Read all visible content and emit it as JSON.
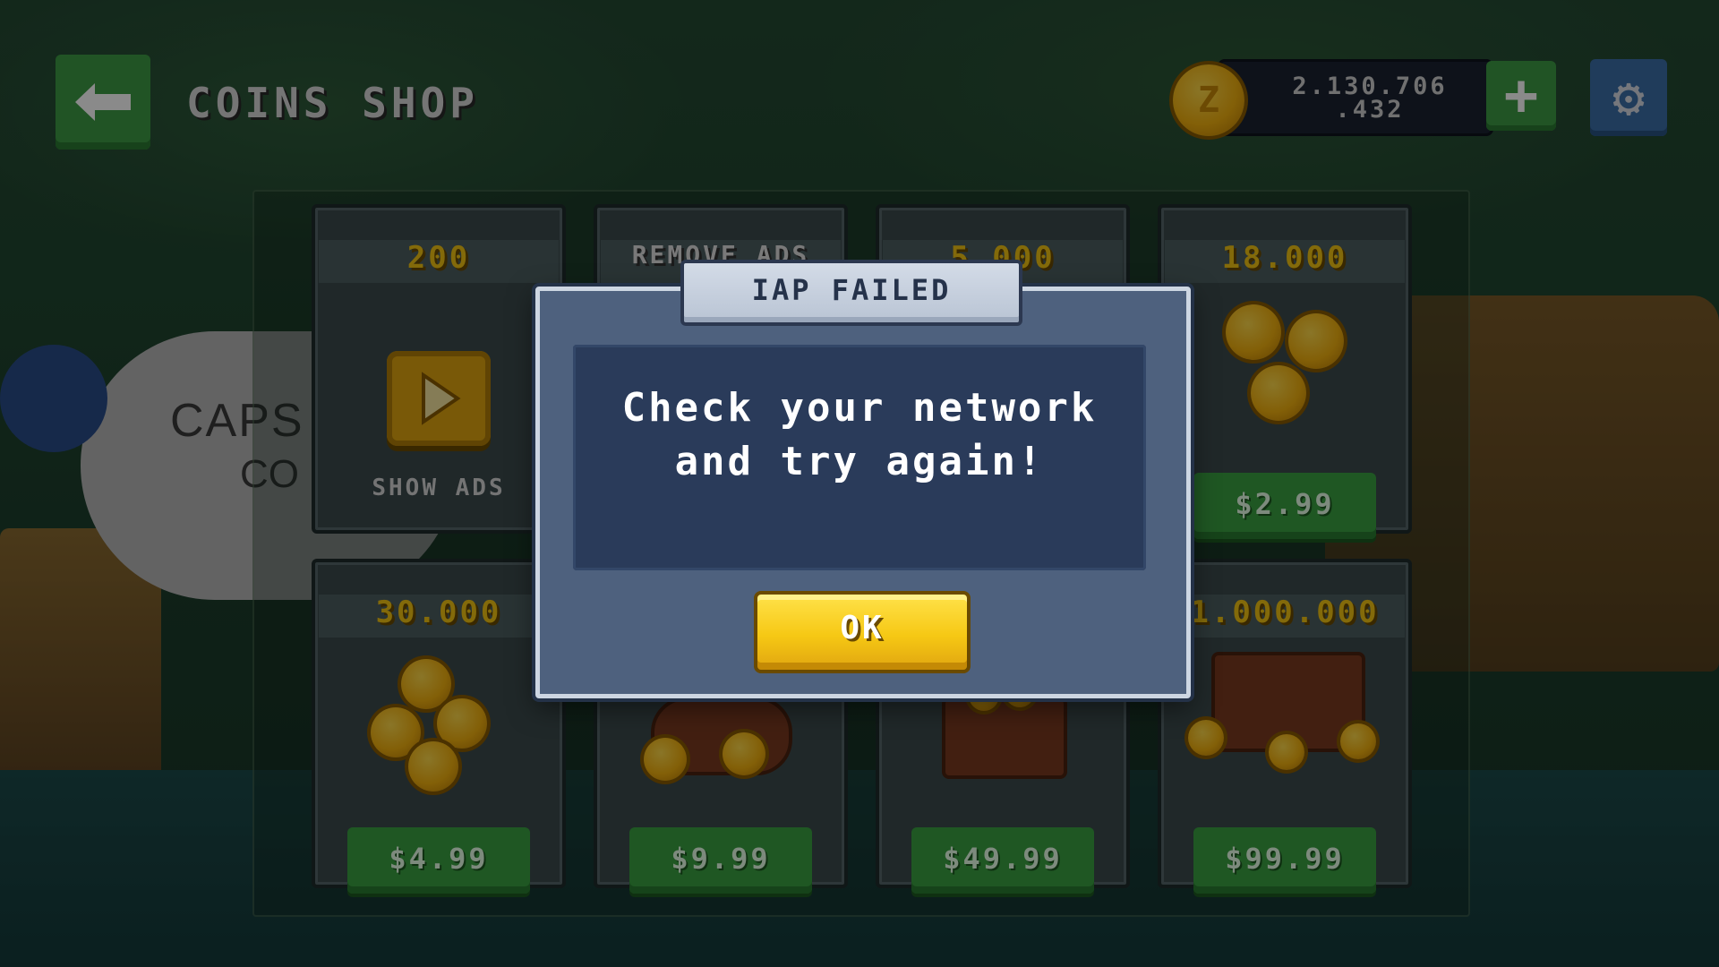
{
  "header": {
    "title": "COINS SHOP",
    "coin_balance": "2.130.706\n.432"
  },
  "shop": {
    "items": [
      {
        "amount": "200",
        "action_label": "SHOW ADS"
      },
      {
        "amount": "REMOVE ADS"
      },
      {
        "amount": "5.000"
      },
      {
        "amount": "18.000",
        "price": "$2.99"
      },
      {
        "amount": "30.000",
        "price": "$4.99"
      },
      {
        "price": "$9.99"
      },
      {
        "price": "$49.99"
      },
      {
        "amount": "1.000.000",
        "price": "$99.99"
      }
    ]
  },
  "modal": {
    "title": "IAP FAILED",
    "message": "Check your network and try again!",
    "ok_label": "OK"
  },
  "icons": {
    "back": "back-arrow-icon",
    "coin": "z-coin-icon",
    "add": "plus-icon",
    "settings": "gear-icon",
    "play": "play-video-icon"
  },
  "colors": {
    "accent_green": "#3d9b45",
    "coin_gold": "#f2c413",
    "settings_blue": "#3b6fa8",
    "modal_bg": "#4e617e",
    "ok_yellow": "#f6c814"
  }
}
